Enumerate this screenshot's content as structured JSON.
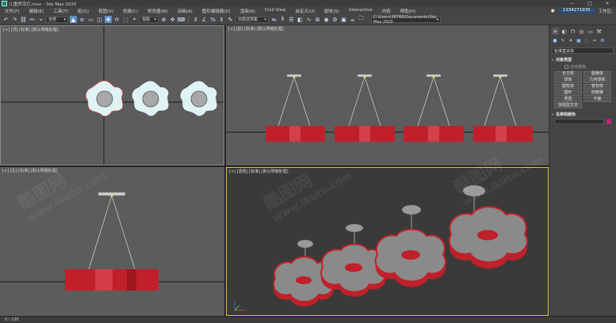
{
  "window": {
    "title": "儿童房吊灯.max - 3ds Max 2020",
    "controls": [
      "—",
      "□",
      "✕"
    ]
  },
  "menu": {
    "items": [
      "文件(F)",
      "编辑(E)",
      "工具(T)",
      "组(G)",
      "视图(V)",
      "创建(C)",
      "修改器(M)",
      "动画(A)",
      "图形编辑器(D)",
      "渲染(R)",
      "Civil View",
      "自定义(U)",
      "脚本(S)",
      "Interactive",
      "内容",
      "帮助(H)"
    ],
    "user": "1334271935",
    "workspace": "工作区:"
  },
  "toolbar": {
    "selection_filter": "全部",
    "view_dropdown": "视图",
    "named_set": "创建选择集",
    "path": "C:\\Users\\36768\\Documents\\3ds Max 2020"
  },
  "viewports": {
    "top": "[+] [顶] [标准] [默认明暗处理]",
    "front": "[+] [前] [标准] [默认明暗处理]",
    "left": "[+] [左] [标准] [默认明暗处理]",
    "perspective": "[+] [透视] [标准] [默认明暗处理]"
  },
  "command_panel": {
    "category": "标准基本体",
    "object_type_title": "对象类型",
    "autogrid_label": "自动栅格",
    "objects": [
      "长方体",
      "圆锥体",
      "球体",
      "几何球体",
      "圆柱体",
      "管状体",
      "圆环",
      "四棱锥",
      "茶壶",
      "平面",
      "加强型文本"
    ],
    "name_color_title": "名称和颜色",
    "color_swatch": "#c3217a"
  },
  "status": {
    "left": "0 / 100"
  },
  "watermark": {
    "brand": "酷图网",
    "url": "www.ikutu.com"
  },
  "colors": {
    "lamp_red": "#c0202a",
    "flower_fill": "#dff3f5",
    "accent_select": "#5d8fc8",
    "active_viewport_border": "#e8c24a"
  }
}
